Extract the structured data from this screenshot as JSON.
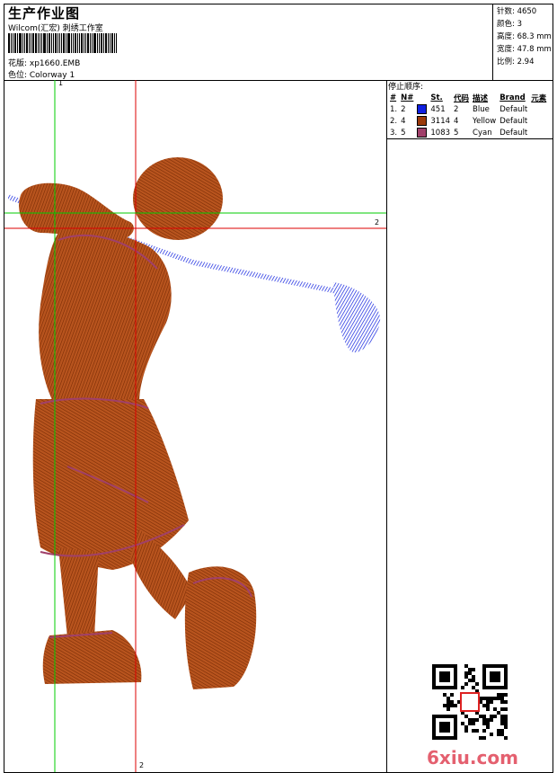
{
  "header": {
    "title": "生产作业图",
    "subtitle": "Wilcom(汇宏) 刺绣工作室",
    "pattern_label": "花版: xp1660.EMB",
    "colorway_label": "色位: Colorway 1"
  },
  "stats": {
    "stitches": "针数: 4650",
    "colors": "颜色: 3",
    "height": "高度: 68.3 mm",
    "width": "宽度: 47.8 mm",
    "scale": "比例: 2.94"
  },
  "stop_sequence": {
    "title": "停止顺序:",
    "headers": [
      "#",
      "N#",
      "St.",
      "代码",
      "描述",
      "Brand",
      "元素"
    ],
    "rows": [
      {
        "idx": "1.",
        "n": "2",
        "color": "#1020e0",
        "st": "451",
        "code": "2",
        "desc": "Blue",
        "brand": "Default"
      },
      {
        "idx": "2.",
        "n": "4",
        "color": "#9a3a0a",
        "st": "3114",
        "code": "4",
        "desc": "Yellow",
        "brand": "Default"
      },
      {
        "idx": "3.",
        "n": "5",
        "color": "#a0406a",
        "st": "1083",
        "code": "5",
        "desc": "Cyan",
        "brand": "Default"
      }
    ]
  },
  "guides": {
    "vertical_green_label": "1",
    "vertical_red_label": "2",
    "horizontal_red_label": "2"
  },
  "watermark": "6xiu.com",
  "colors": {
    "brown": "#9a3a0a",
    "blue": "#1020e0",
    "purple": "#a0406a",
    "guide_green": "#00cc00",
    "guide_red": "#dd0000"
  }
}
